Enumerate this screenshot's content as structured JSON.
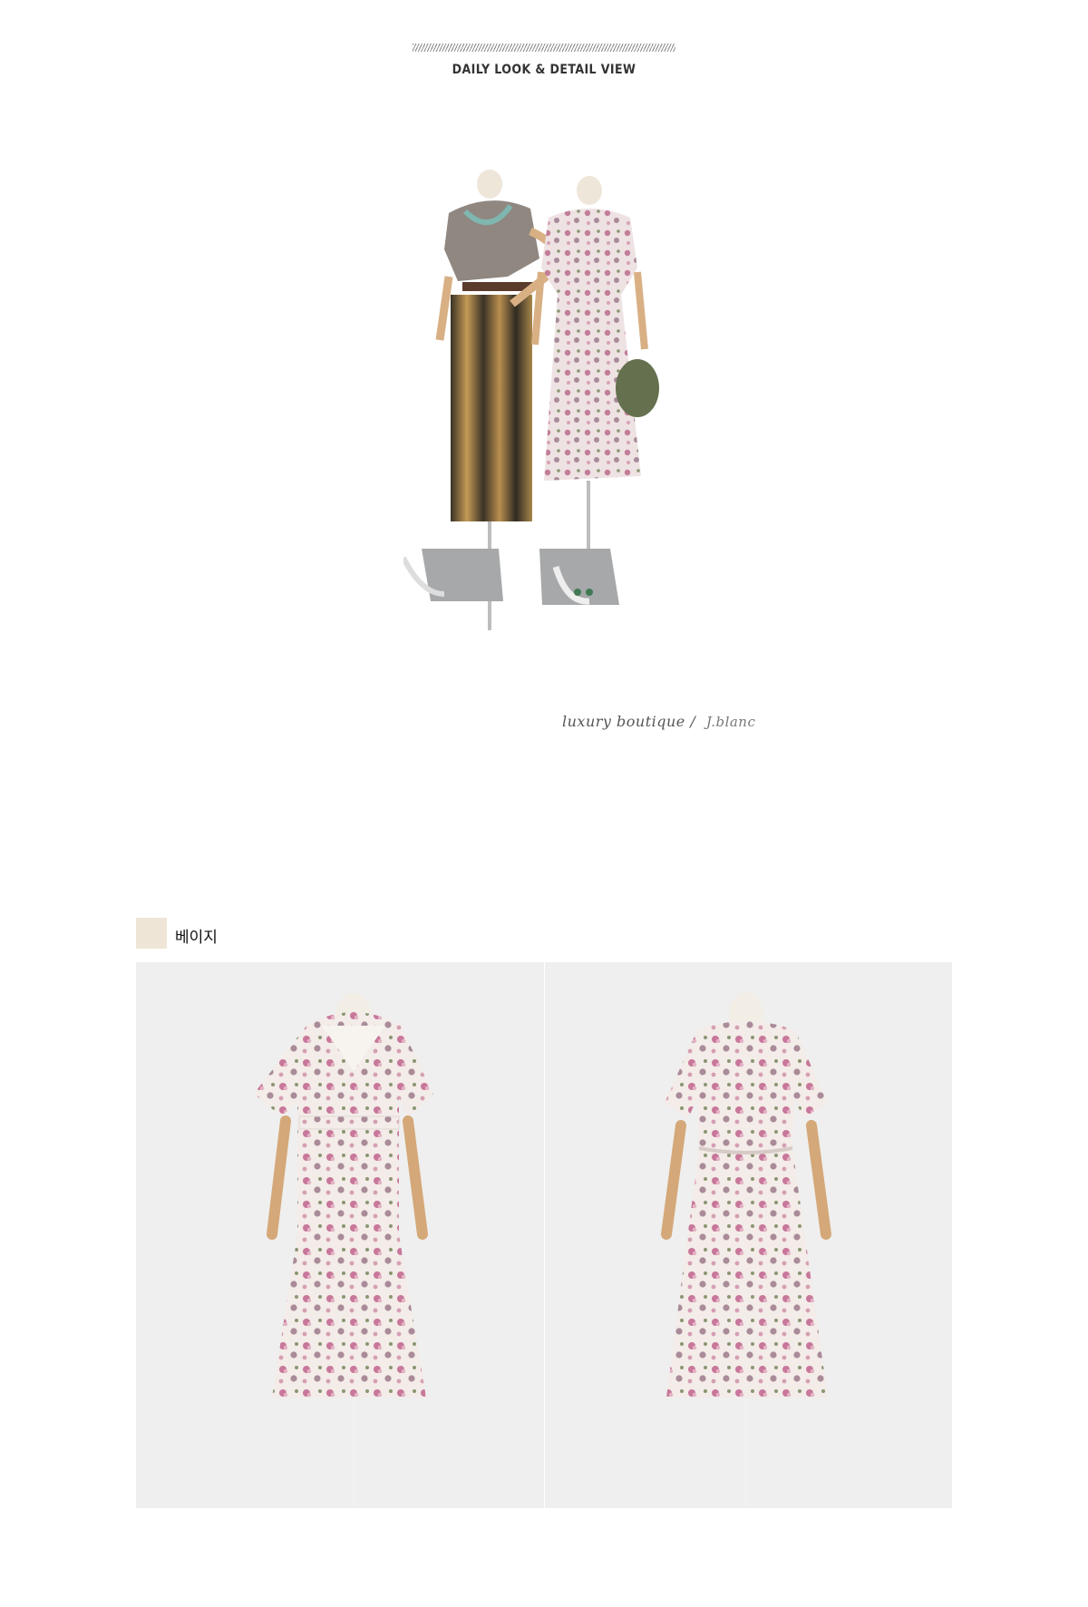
{
  "header": {
    "title": "DAILY LOOK & DETAIL VIEW"
  },
  "daily_look": {
    "caption": "luxury boutique",
    "separator": "/",
    "signature": "J.blanc"
  },
  "color_option": {
    "label": "베이지",
    "swatch_color": "#efe5d6"
  },
  "colors": {
    "photo_background": "#efefef",
    "dress_base": "#f3ece8",
    "flower_pink": "#c8779a",
    "flower_mauve": "#a98b99",
    "leaf_green": "#8a9672"
  }
}
